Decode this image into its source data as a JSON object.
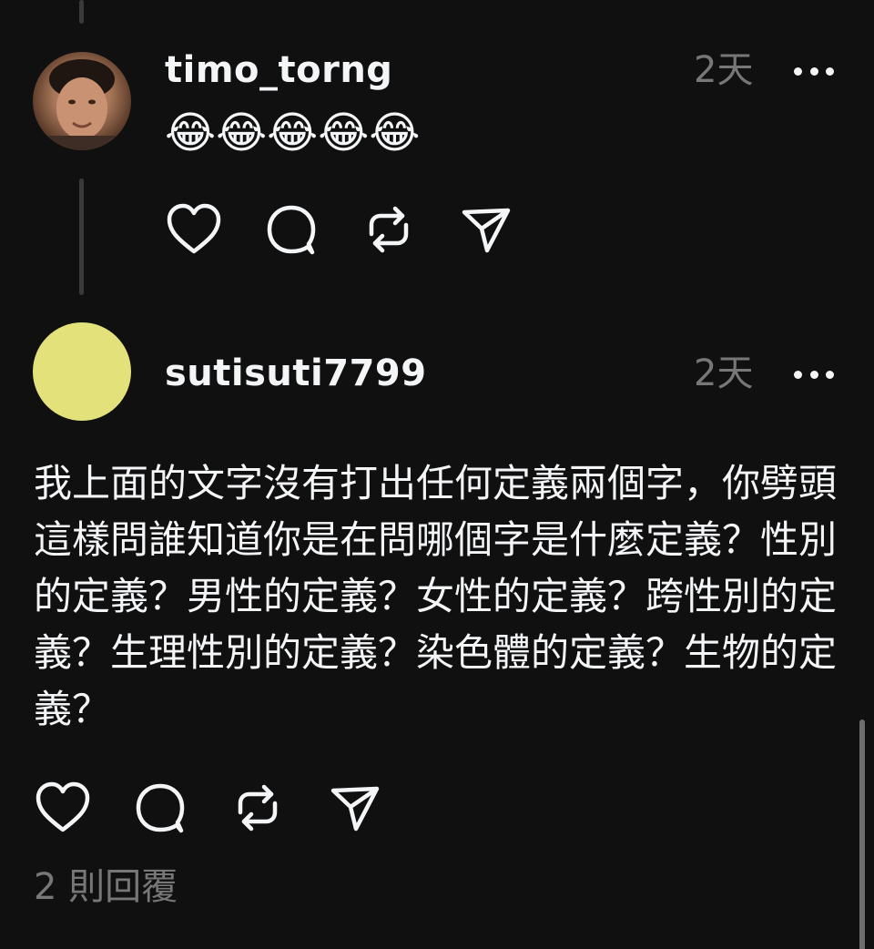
{
  "reply1": {
    "username": "timo_torng",
    "time": "2天",
    "content": "😂😂😂😂😂",
    "avatar_icon": "profile-photo"
  },
  "post": {
    "username": "sutisuti7799",
    "time": "2天",
    "avatar_color": "#e3e27a",
    "body": "我上面的文字沒有打出任何定義兩個字，你劈頭這樣問誰知道你是在問哪個字是什麼定義？性別的定義？男性的定義？女性的定義？跨性別的定義？生理性別的定義？染色體的定義？生物的定義？",
    "replies": "2 則回覆"
  },
  "icons": {
    "like": "heart-icon",
    "comment": "comment-icon",
    "repost": "repost-icon",
    "share": "send-icon",
    "more": "more-icon"
  },
  "colors": {
    "background": "#101010",
    "primary_text": "#f3f5f7",
    "secondary_text": "#777777",
    "thread_line": "#3a3a3a"
  }
}
